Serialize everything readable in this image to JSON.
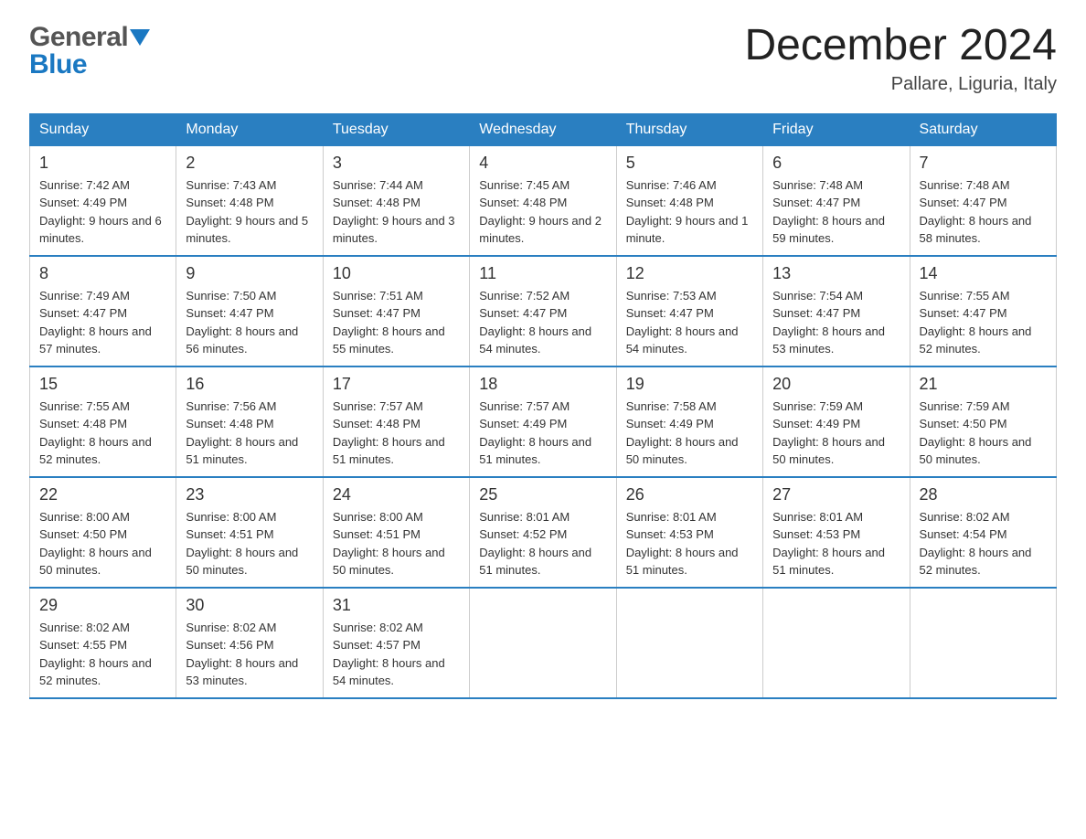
{
  "header": {
    "logo_general": "General",
    "logo_blue": "Blue",
    "month_title": "December 2024",
    "location": "Pallare, Liguria, Italy"
  },
  "days_of_week": [
    "Sunday",
    "Monday",
    "Tuesday",
    "Wednesday",
    "Thursday",
    "Friday",
    "Saturday"
  ],
  "weeks": [
    [
      {
        "day": "1",
        "sunrise": "7:42 AM",
        "sunset": "4:49 PM",
        "daylight": "9 hours and 6 minutes."
      },
      {
        "day": "2",
        "sunrise": "7:43 AM",
        "sunset": "4:48 PM",
        "daylight": "9 hours and 5 minutes."
      },
      {
        "day": "3",
        "sunrise": "7:44 AM",
        "sunset": "4:48 PM",
        "daylight": "9 hours and 3 minutes."
      },
      {
        "day": "4",
        "sunrise": "7:45 AM",
        "sunset": "4:48 PM",
        "daylight": "9 hours and 2 minutes."
      },
      {
        "day": "5",
        "sunrise": "7:46 AM",
        "sunset": "4:48 PM",
        "daylight": "9 hours and 1 minute."
      },
      {
        "day": "6",
        "sunrise": "7:48 AM",
        "sunset": "4:47 PM",
        "daylight": "8 hours and 59 minutes."
      },
      {
        "day": "7",
        "sunrise": "7:48 AM",
        "sunset": "4:47 PM",
        "daylight": "8 hours and 58 minutes."
      }
    ],
    [
      {
        "day": "8",
        "sunrise": "7:49 AM",
        "sunset": "4:47 PM",
        "daylight": "8 hours and 57 minutes."
      },
      {
        "day": "9",
        "sunrise": "7:50 AM",
        "sunset": "4:47 PM",
        "daylight": "8 hours and 56 minutes."
      },
      {
        "day": "10",
        "sunrise": "7:51 AM",
        "sunset": "4:47 PM",
        "daylight": "8 hours and 55 minutes."
      },
      {
        "day": "11",
        "sunrise": "7:52 AM",
        "sunset": "4:47 PM",
        "daylight": "8 hours and 54 minutes."
      },
      {
        "day": "12",
        "sunrise": "7:53 AM",
        "sunset": "4:47 PM",
        "daylight": "8 hours and 54 minutes."
      },
      {
        "day": "13",
        "sunrise": "7:54 AM",
        "sunset": "4:47 PM",
        "daylight": "8 hours and 53 minutes."
      },
      {
        "day": "14",
        "sunrise": "7:55 AM",
        "sunset": "4:47 PM",
        "daylight": "8 hours and 52 minutes."
      }
    ],
    [
      {
        "day": "15",
        "sunrise": "7:55 AM",
        "sunset": "4:48 PM",
        "daylight": "8 hours and 52 minutes."
      },
      {
        "day": "16",
        "sunrise": "7:56 AM",
        "sunset": "4:48 PM",
        "daylight": "8 hours and 51 minutes."
      },
      {
        "day": "17",
        "sunrise": "7:57 AM",
        "sunset": "4:48 PM",
        "daylight": "8 hours and 51 minutes."
      },
      {
        "day": "18",
        "sunrise": "7:57 AM",
        "sunset": "4:49 PM",
        "daylight": "8 hours and 51 minutes."
      },
      {
        "day": "19",
        "sunrise": "7:58 AM",
        "sunset": "4:49 PM",
        "daylight": "8 hours and 50 minutes."
      },
      {
        "day": "20",
        "sunrise": "7:59 AM",
        "sunset": "4:49 PM",
        "daylight": "8 hours and 50 minutes."
      },
      {
        "day": "21",
        "sunrise": "7:59 AM",
        "sunset": "4:50 PM",
        "daylight": "8 hours and 50 minutes."
      }
    ],
    [
      {
        "day": "22",
        "sunrise": "8:00 AM",
        "sunset": "4:50 PM",
        "daylight": "8 hours and 50 minutes."
      },
      {
        "day": "23",
        "sunrise": "8:00 AM",
        "sunset": "4:51 PM",
        "daylight": "8 hours and 50 minutes."
      },
      {
        "day": "24",
        "sunrise": "8:00 AM",
        "sunset": "4:51 PM",
        "daylight": "8 hours and 50 minutes."
      },
      {
        "day": "25",
        "sunrise": "8:01 AM",
        "sunset": "4:52 PM",
        "daylight": "8 hours and 51 minutes."
      },
      {
        "day": "26",
        "sunrise": "8:01 AM",
        "sunset": "4:53 PM",
        "daylight": "8 hours and 51 minutes."
      },
      {
        "day": "27",
        "sunrise": "8:01 AM",
        "sunset": "4:53 PM",
        "daylight": "8 hours and 51 minutes."
      },
      {
        "day": "28",
        "sunrise": "8:02 AM",
        "sunset": "4:54 PM",
        "daylight": "8 hours and 52 minutes."
      }
    ],
    [
      {
        "day": "29",
        "sunrise": "8:02 AM",
        "sunset": "4:55 PM",
        "daylight": "8 hours and 52 minutes."
      },
      {
        "day": "30",
        "sunrise": "8:02 AM",
        "sunset": "4:56 PM",
        "daylight": "8 hours and 53 minutes."
      },
      {
        "day": "31",
        "sunrise": "8:02 AM",
        "sunset": "4:57 PM",
        "daylight": "8 hours and 54 minutes."
      },
      null,
      null,
      null,
      null
    ]
  ],
  "labels": {
    "sunrise": "Sunrise:",
    "sunset": "Sunset:",
    "daylight": "Daylight:"
  }
}
